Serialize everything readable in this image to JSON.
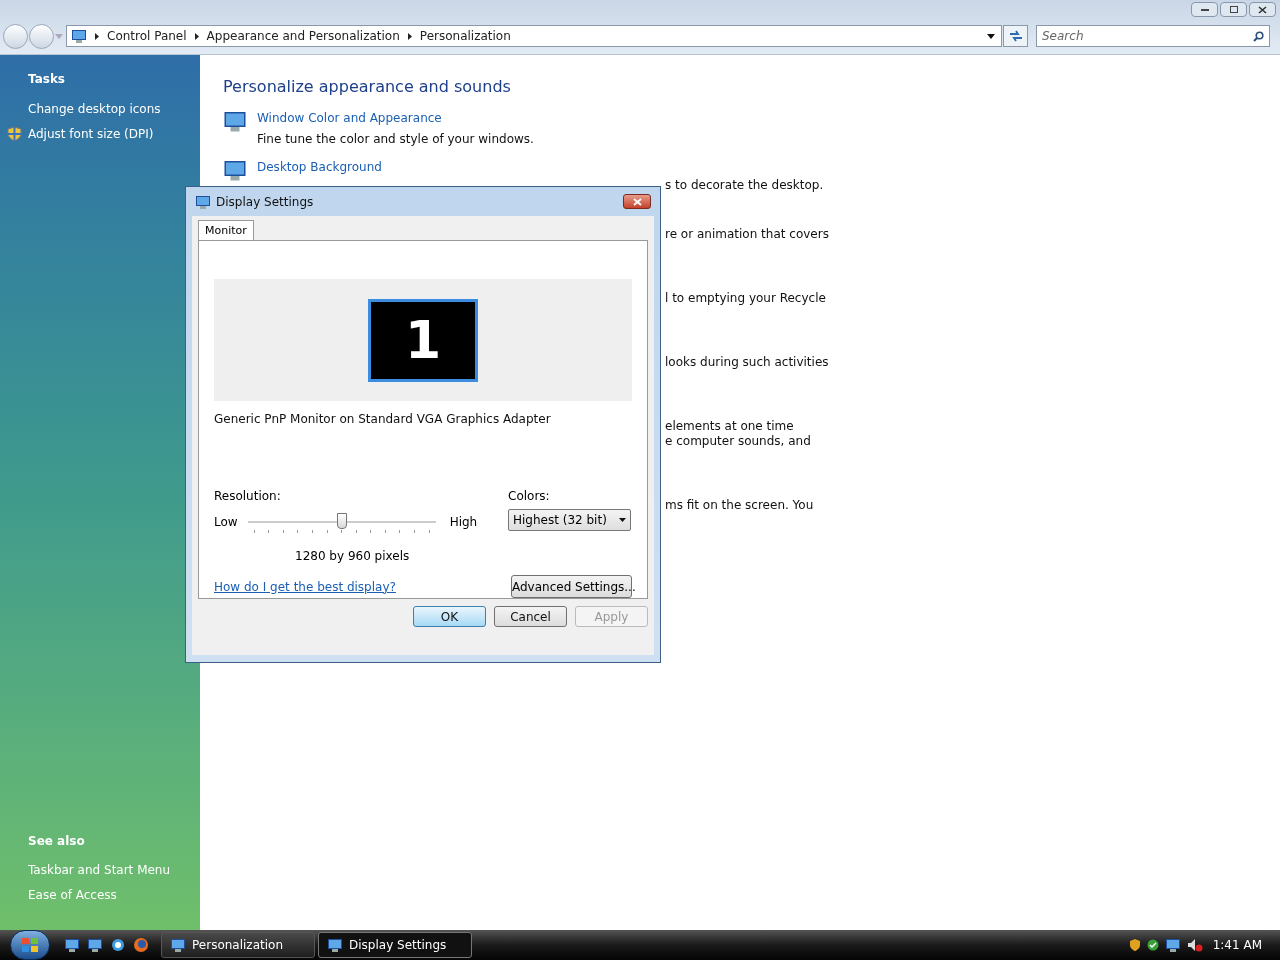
{
  "window": {
    "breadcrumbs": [
      "Control Panel",
      "Appearance and Personalization",
      "Personalization"
    ],
    "search": {
      "placeholder": "Search"
    }
  },
  "sidebar": {
    "tasks_title": "Tasks",
    "tasks": [
      {
        "label": "Change desktop icons",
        "kind": "link"
      },
      {
        "label": "Adjust font size (DPI)",
        "kind": "shield"
      }
    ],
    "see_also_title": "See also",
    "see_also": [
      "Taskbar and Start Menu",
      "Ease of Access"
    ]
  },
  "content": {
    "heading": "Personalize appearance and sounds",
    "items": [
      {
        "title": "Window Color and Appearance",
        "description": "Fine tune the color and style of your windows."
      },
      {
        "title": "Desktop Background"
      }
    ],
    "fragments": [
      [
        "s to decorate the desktop."
      ],
      [
        "re or animation that covers"
      ],
      [
        "l to emptying your Recycle"
      ],
      [
        "looks during such activities"
      ],
      [
        "elements at one time",
        "e computer sounds, and"
      ],
      [
        "ms fit on the screen. You"
      ]
    ]
  },
  "dialog": {
    "title": "Display Settings",
    "tabs": [
      {
        "label": "Monitor",
        "selected": true
      }
    ],
    "monitor_number": "1",
    "monitor_name": "Generic PnP Monitor on Standard VGA Graphics Adapter",
    "resolution_label": "Resolution:",
    "low": "Low",
    "high": "High",
    "resolution": {
      "level": 0.5
    },
    "resolution_text": "1280 by 960 pixels",
    "colors_label": "Colors:",
    "colors_value": "Highest (32 bit)",
    "help_link": "How do I get the best display?",
    "advanced_button": "Advanced Settings...",
    "buttons": [
      {
        "label": "OK",
        "kind": "default",
        "disabled": false
      },
      {
        "label": "Cancel",
        "kind": "normal",
        "disabled": false
      },
      {
        "label": "Apply",
        "kind": "normal",
        "disabled": true
      }
    ]
  },
  "taskbar": {
    "tasks": [
      {
        "label": "Personalization",
        "selected": false
      },
      {
        "label": "Display Settings",
        "selected": true
      }
    ],
    "clock": "1:41 AM"
  }
}
